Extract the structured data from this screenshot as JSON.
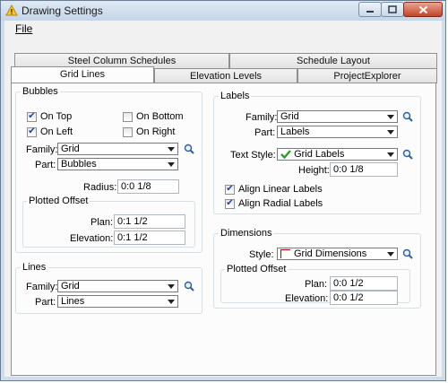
{
  "window": {
    "title": "Drawing Settings"
  },
  "menu": {
    "file": "File"
  },
  "tabs_row1": [
    "Steel Column Schedules",
    "Schedule Layout"
  ],
  "tabs_row2": [
    "Grid Lines",
    "Elevation Levels",
    "ProjectExplorer"
  ],
  "bubbles": {
    "group": "Bubbles",
    "on_top": "On Top",
    "on_top_checked": true,
    "on_bottom": "On Bottom",
    "on_bottom_checked": false,
    "on_left": "On Left",
    "on_left_checked": true,
    "on_right": "On Right",
    "on_right_checked": false,
    "family_label": "Family:",
    "family_value": "Grid",
    "part_label": "Part:",
    "part_value": "Bubbles",
    "radius_label": "Radius:",
    "radius_value": "0:0 1/8"
  },
  "plotted_offset_bubbles": {
    "group": "Plotted Offset",
    "plan_label": "Plan:",
    "plan_value": "0:1 1/2",
    "elevation_label": "Elevation:",
    "elevation_value": "0:1 1/2"
  },
  "lines": {
    "group": "Lines",
    "family_label": "Family:",
    "family_value": "Grid",
    "part_label": "Part:",
    "part_value": "Lines"
  },
  "labels": {
    "group": "Labels",
    "family_label": "Family:",
    "family_value": "Grid",
    "part_label": "Part:",
    "part_value": "Labels",
    "text_style_label": "Text Style:",
    "text_style_value": "Grid Labels",
    "height_label": "Height:",
    "height_value": "0:0 1/8",
    "align_linear": "Align Linear Labels",
    "align_linear_checked": true,
    "align_radial": "Align Radial Labels",
    "align_radial_checked": true
  },
  "dimensions": {
    "group": "Dimensions",
    "style_label": "Style:",
    "style_value": "Grid Dimensions"
  },
  "plotted_offset_dims": {
    "group": "Plotted Offset",
    "plan_label": "Plan:",
    "plan_value": "0:0 1/2",
    "elevation_label": "Elevation:",
    "elevation_value": "0:0 1/2"
  },
  "colors": {
    "accent_blue": "#1f3f9a",
    "close_red": "#c4422a",
    "window_frame": "#cfdcea"
  },
  "icons": {
    "search": "magnifier-icon",
    "text_style": "green-check-icon",
    "dim_style": "dimension-icon"
  }
}
